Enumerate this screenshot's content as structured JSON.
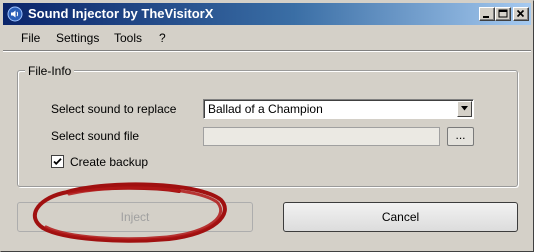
{
  "window": {
    "title": "Sound Injector by TheVisitorX"
  },
  "menu": {
    "items": [
      "File",
      "Settings",
      "Tools",
      "?"
    ]
  },
  "file_info": {
    "group_label": "File-Info",
    "replace_label": "Select sound to replace",
    "replace_selected": "Ballad of a Champion",
    "file_label": "Select sound file",
    "file_value": "",
    "browse_label": "...",
    "backup_label": "Create backup",
    "backup_checked": true
  },
  "actions": {
    "inject_label": "Inject",
    "inject_enabled": false,
    "cancel_label": "Cancel"
  },
  "colors": {
    "title_bar": "#0a246a",
    "annotation": "#a01010"
  }
}
